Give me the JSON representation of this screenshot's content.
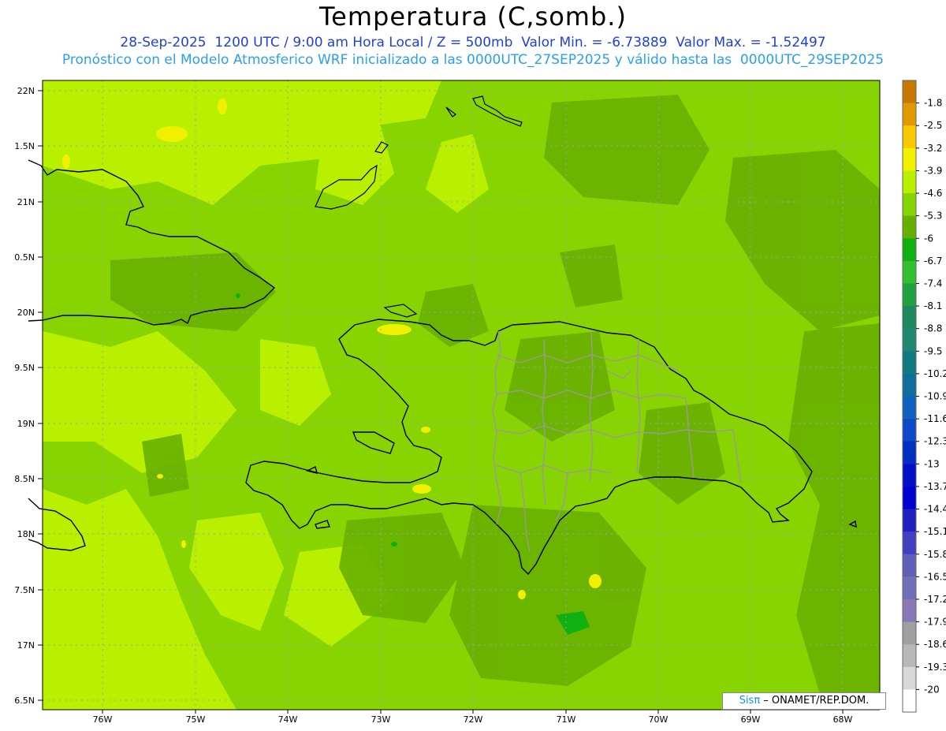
{
  "title": "Temperatura (C,somb.)",
  "subtitle_line1": "28-Sep-2025  1200 UTC / 9:00 am Hora Local / Z = 500mb  Valor Min. = -6.73889  Valor Max. = -1.52497",
  "subtitle_line2": "Pronóstico con el Modelo Atmosferico WRF inicializado a las 0000UTC_27SEP2025 y válido hasta las  0000UTC_29SEP2025",
  "credit": {
    "brand": "Sisπ",
    "text": " – ONAMET/REP.DOM."
  },
  "lat_ticks": [
    "22N",
    "1.5N",
    "21N",
    "0.5N",
    "20N",
    "9.5N",
    "19N",
    "8.5N",
    "18N",
    "7.5N",
    "17N",
    "6.5N"
  ],
  "lon_ticks": [
    "76W",
    "75W",
    "74W",
    "73W",
    "72W",
    "71W",
    "70W",
    "69W",
    "68W"
  ],
  "colorbar": {
    "labels": [
      "-1.8",
      "-2.5",
      "-3.2",
      "-3.9",
      "-4.6",
      "-5.3",
      "-6",
      "-6.7",
      "-7.4",
      "-8.1",
      "-8.8",
      "-9.5",
      "-10.2",
      "-10.9",
      "-11.6",
      "-12.3",
      "-13",
      "-13.7",
      "-14.4",
      "-15.1",
      "-15.8",
      "-16.5",
      "-17.2",
      "-17.9",
      "-18.6",
      "-19.3",
      "-20"
    ],
    "colors": [
      "#c87800",
      "#e09a00",
      "#f8c800",
      "#f0f000",
      "#b8f000",
      "#88d400",
      "#68b000",
      "#10b010",
      "#30c030",
      "#20a040",
      "#208860",
      "#208870",
      "#107a80",
      "#106f9a",
      "#1060c0",
      "#1048c8",
      "#0030c0",
      "#0010c8",
      "#0000d0",
      "#2020c0",
      "#4040c0",
      "#6060b8",
      "#7070b8",
      "#8878b8",
      "#a0a0a0",
      "#b8b8b8",
      "#d8d8d8",
      "#ffffff"
    ]
  },
  "colors": {
    "field_base": "#88d400",
    "field_light": "#b8f000",
    "field_dark": "#68b000"
  }
}
